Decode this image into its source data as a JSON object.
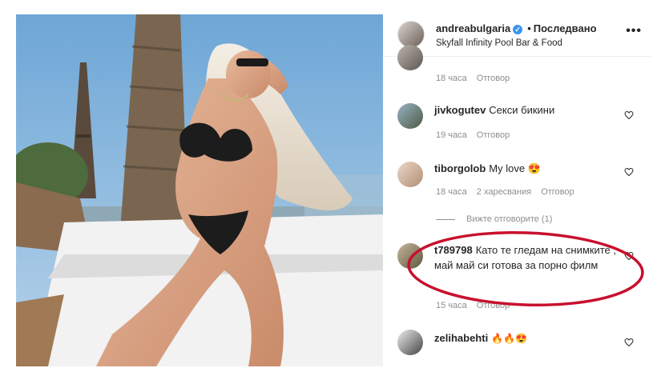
{
  "header": {
    "username": "andreabulgaria",
    "verified_mark": "✓",
    "separator": "•",
    "follow_status": "Последвано",
    "location": "Skyfall Infinity Pool Bar & Food",
    "more_icon": "•••"
  },
  "comments": [
    {
      "username": "",
      "text": "",
      "time": "18 часа",
      "reply": "Отговор"
    },
    {
      "username": "jivkogutev",
      "text": "Секси бикини",
      "time": "19 часа",
      "reply": "Отговор"
    },
    {
      "username": "tiborgolob",
      "text": "My love 😍",
      "time": "18 часа",
      "likes": "2 харесвания",
      "reply": "Отговор"
    },
    {
      "username": "t789798",
      "text": "Като те гледам на снимките , май май си готова за порно филм",
      "time": "15 часа",
      "reply": "Отговор"
    },
    {
      "username": "zelihabehti",
      "text": "🔥🔥😍"
    }
  ],
  "view_replies": "Вижте отговорите (1)",
  "colors": {
    "accent": "#3897f0",
    "meta": "#8e8e8e",
    "highlight": "#c8102e"
  }
}
